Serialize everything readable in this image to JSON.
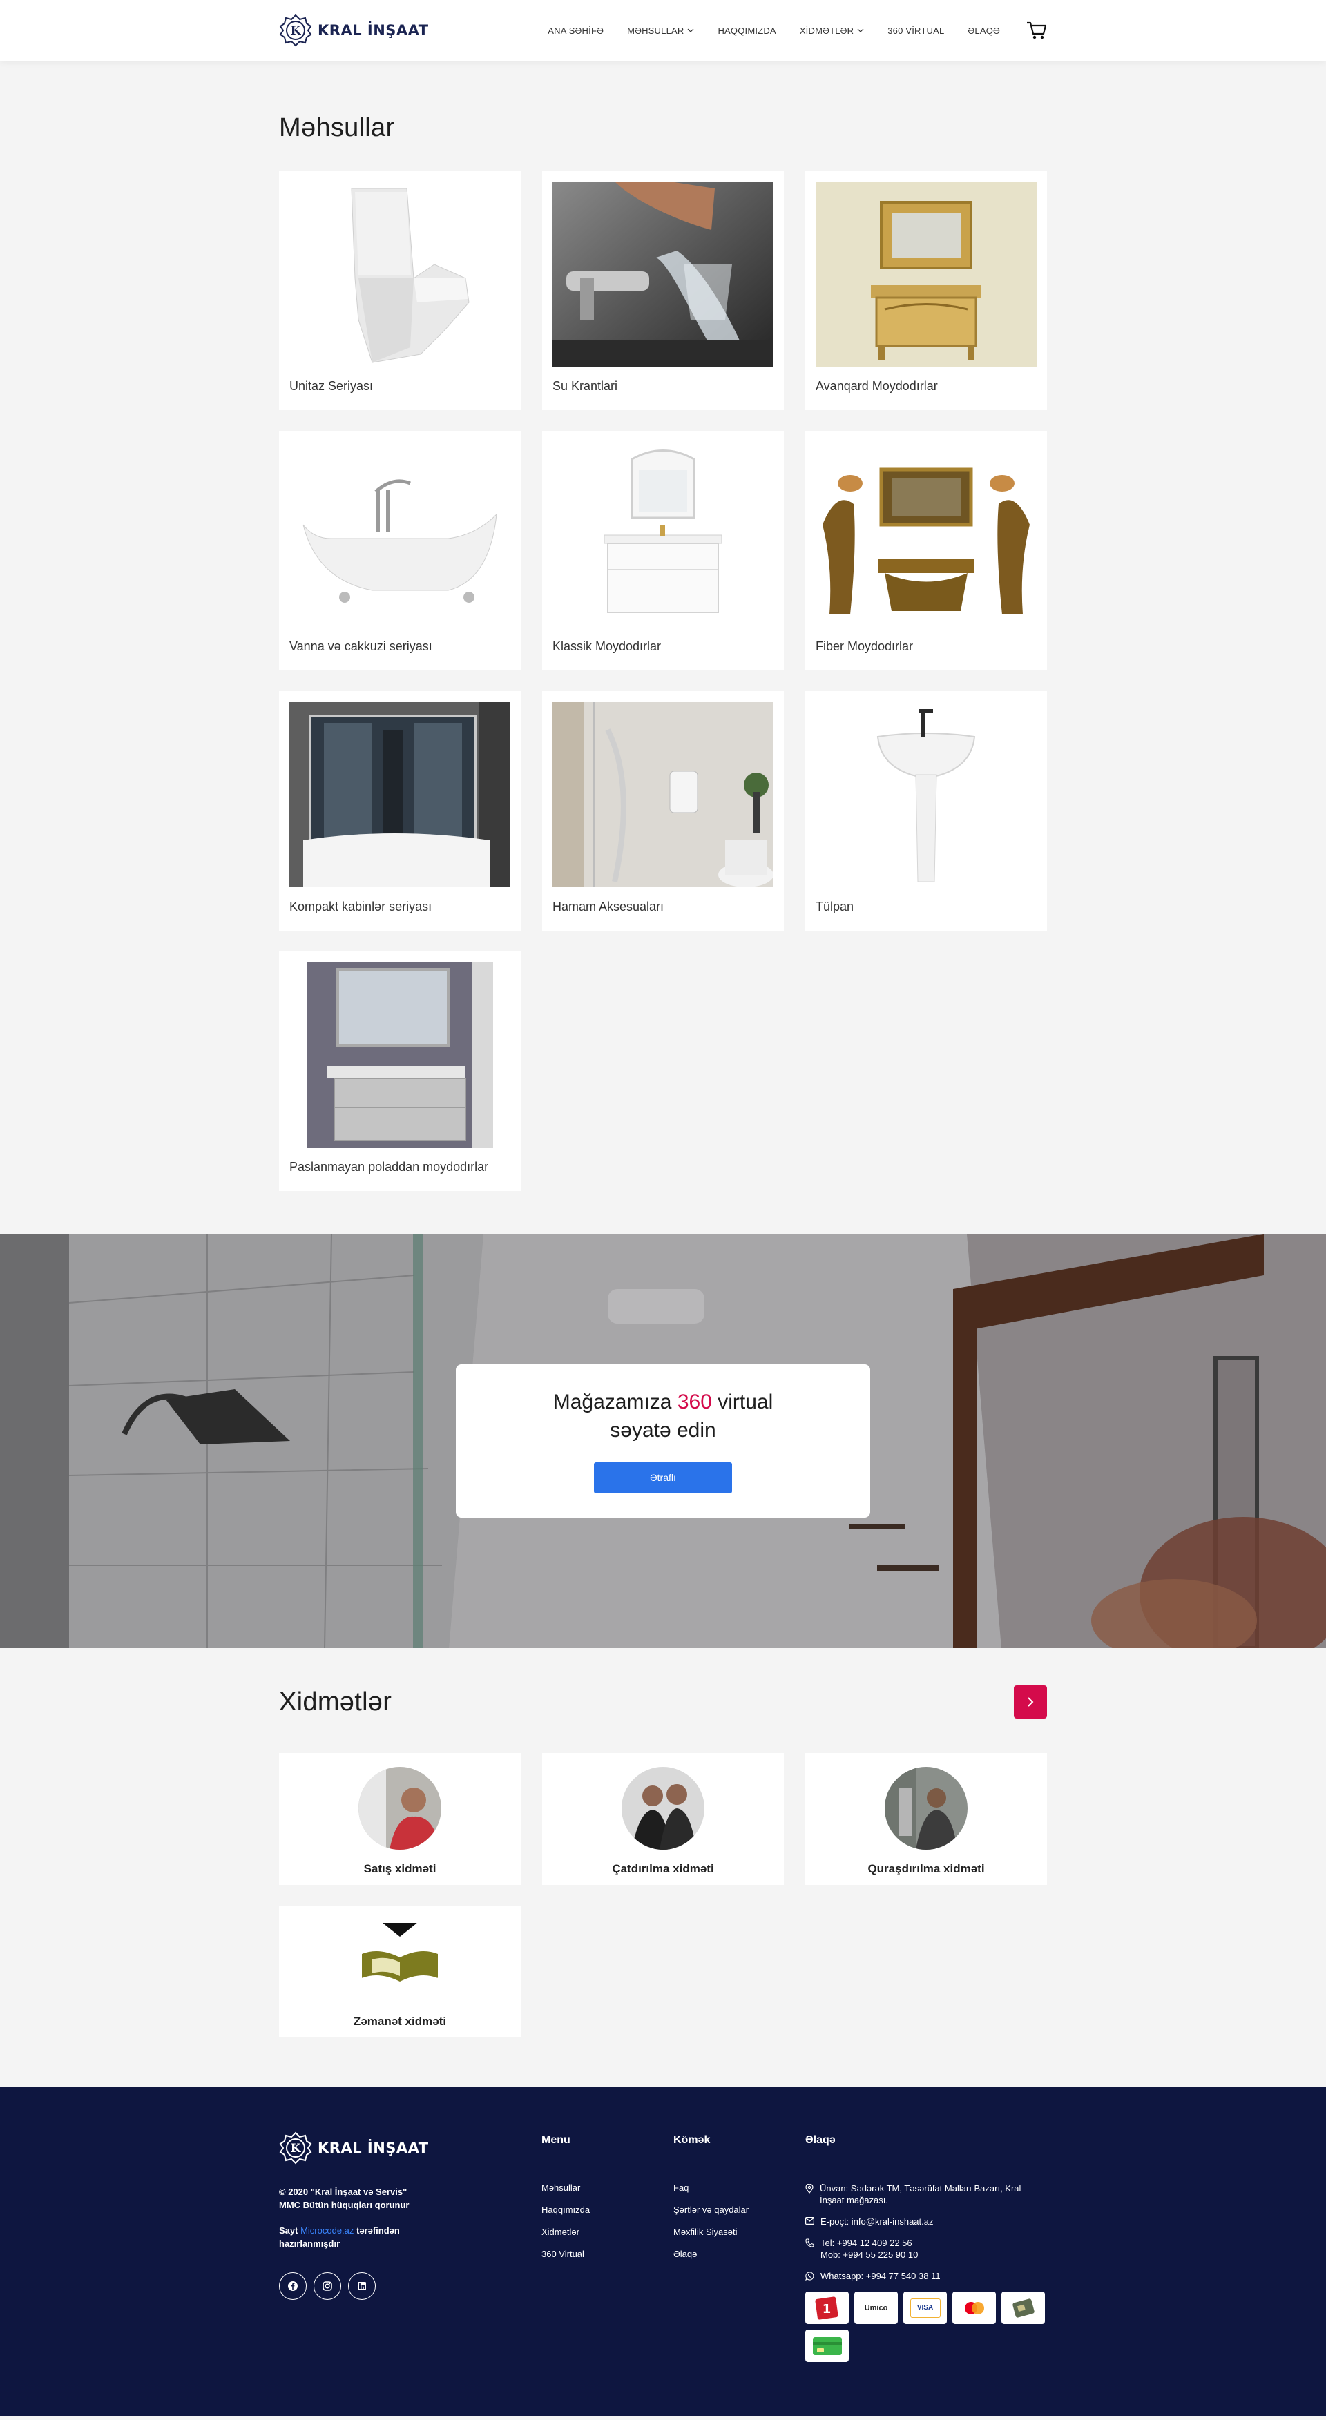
{
  "brand": {
    "name": "KRAL İNŞAAT"
  },
  "nav": [
    {
      "label": "ANA SƏHİFƏ",
      "dropdown": false
    },
    {
      "label": "MƏHSULLAR",
      "dropdown": true
    },
    {
      "label": "HAQQIMIZDA",
      "dropdown": false
    },
    {
      "label": "XİDMƏTLƏR",
      "dropdown": true
    },
    {
      "label": "360 VİRTUAL",
      "dropdown": false
    },
    {
      "label": "ƏLAQƏ",
      "dropdown": false
    }
  ],
  "products": {
    "title": "Məhsullar",
    "items": [
      {
        "name": "Unitaz Seriyası"
      },
      {
        "name": "Su Krantlari"
      },
      {
        "name": "Avanqard Moydodırlar"
      },
      {
        "name": "Vanna və cakkuzi seriyası"
      },
      {
        "name": "Klassik Moydodırlar"
      },
      {
        "name": "Fiber Moydodırlar"
      },
      {
        "name": "Kompakt kabinlər seriyası"
      },
      {
        "name": "Hamam Aksesuaları"
      },
      {
        "name": "Tülpan"
      },
      {
        "name": "Paslanmayan poladdan moydodırlar"
      }
    ]
  },
  "banner": {
    "title_pre": "Mağazamıza ",
    "title_highlight": "360",
    "title_post": " virtual",
    "title_line2": "səyatə edin",
    "button": "Ətraflı"
  },
  "services": {
    "title": "Xidmətlər",
    "items": [
      {
        "label": "Satış xidməti"
      },
      {
        "label": "Çatdırılma xidməti"
      },
      {
        "label": "Quraşdırılma xidməti"
      },
      {
        "label": "Zəmanət xidməti"
      }
    ]
  },
  "footer": {
    "copyright_line1": "© 2020 \"Kral İnşaat və Servis\"",
    "copyright_line2": "MMC Bütün hüquqları qorunur",
    "made_pre": "Sayt ",
    "made_link": "Microcode.az",
    "made_post": " tərəfindən",
    "made_line2": "hazırlanmışdır",
    "menu_title": "Menu",
    "menu_items": [
      "Məhsullar",
      "Haqqımızda",
      "Xidmətlər",
      "360 Virtual"
    ],
    "help_title": "Kömək",
    "help_items": [
      "Faq",
      "Şərtlər və qaydalar",
      "Məxfilik Siyasəti",
      "Əlaqə"
    ],
    "contact_title": "Əlaqə",
    "address": "Ünvan: Sədərək TM, Təsərüfat Malları Bazarı, Kral İnşaat mağazası.",
    "email": "E-poçt: info@kral-inshaat.az",
    "phone1": "Tel: +994 12 409 22 56",
    "phone2": "Mob: +994 55 225 90 10",
    "whatsapp": "Whatsapp: +994 77 540 38 11",
    "payments": [
      "",
      "Umico",
      "VISA",
      "",
      "",
      ""
    ]
  }
}
